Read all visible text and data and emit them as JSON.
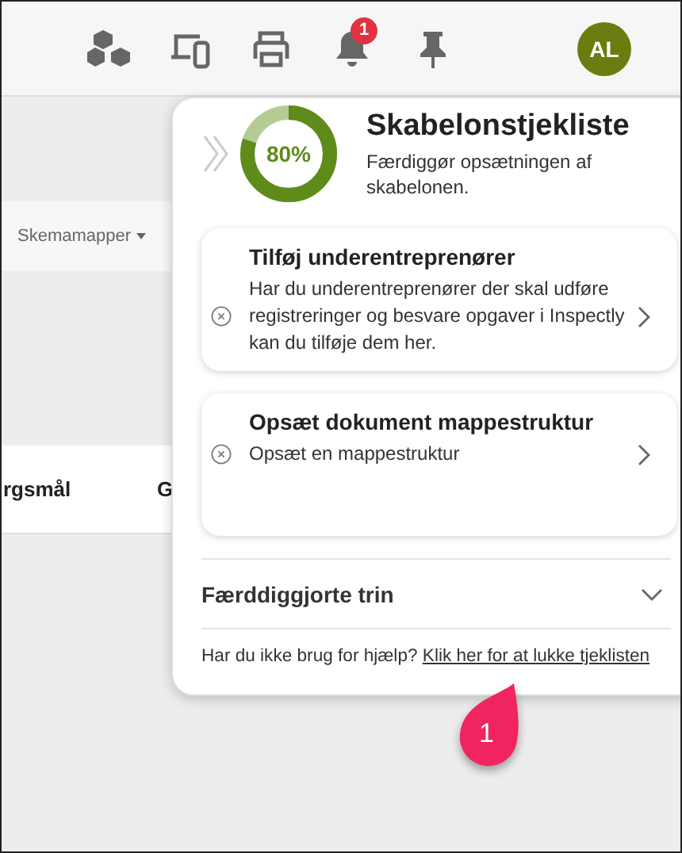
{
  "toolbar": {
    "notification_count": "1",
    "avatar": "AL"
  },
  "background": {
    "folder_menu": "Skemamapper",
    "column_1": "rgsmål",
    "column_2": "G"
  },
  "checklist": {
    "progress": {
      "level": 0.8,
      "label": "80%"
    },
    "title": "Skabelonstjekliste",
    "subtitle": "Færdiggør opsætningen af skabelonen.",
    "tasks": [
      {
        "title": "Tilføj underentreprenører",
        "description": "Har du underentreprenører der skal udføre registreringer og besvare opgaver i Inspectly kan du tilføje dem her."
      },
      {
        "title": "Opsæt dokument mappestruktur",
        "description": "Opsæt en mappestruktur"
      }
    ],
    "completed_section": {
      "label": "Færddiggjorte trin",
      "expanded": false
    },
    "footer": {
      "text": "Har du ikke brug for hjælp?",
      "link": "Klik her for at lukke tjeklisten"
    }
  },
  "hotspot": {
    "label": "1"
  }
}
